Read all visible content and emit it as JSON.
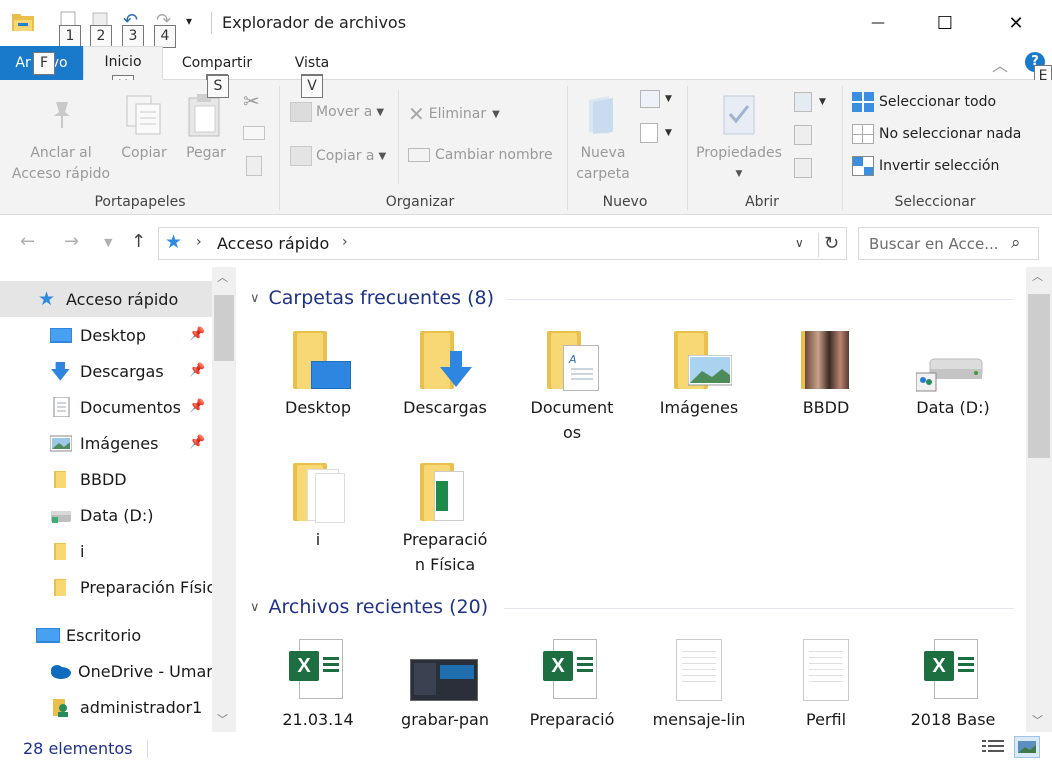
{
  "window": {
    "title": "Explorador de archivos",
    "qat_keytips": [
      "1",
      "2",
      "3",
      "4"
    ],
    "controls": {
      "minimize": "—",
      "maximize": "☐",
      "close": "✕"
    }
  },
  "ribbon_tabs": {
    "file": "Archivo",
    "file_pre": "Ar",
    "file_post": "vo",
    "file_keytip": "F",
    "home": "Inicio",
    "home_keytip": "H",
    "share": "Compartir",
    "share_keytip": "S",
    "view": "Vista",
    "view_keytip": "V",
    "help_keytip": "E"
  },
  "ribbon": {
    "portapapeles": {
      "label": "Portapapeles",
      "pin_line1": "Anclar al",
      "pin_line2": "Acceso rápido",
      "copy": "Copiar",
      "paste": "Pegar"
    },
    "organizar": {
      "label": "Organizar",
      "move_to": "Mover a",
      "copy_to": "Copiar a",
      "delete": "Eliminar",
      "rename": "Cambiar nombre"
    },
    "nuevo": {
      "label": "Nuevo",
      "new_folder_line1": "Nueva",
      "new_folder_line2": "carpeta"
    },
    "abrir": {
      "label": "Abrir",
      "properties": "Propiedades"
    },
    "seleccionar": {
      "label": "Seleccionar",
      "select_all": "Seleccionar todo",
      "select_none": "No seleccionar nada",
      "invert": "Invertir selección"
    }
  },
  "address": {
    "path": "Acceso rápido",
    "search_placeholder": "Buscar en Acce..."
  },
  "nav": {
    "items": [
      {
        "label": "Acceso rápido",
        "pinned": false
      },
      {
        "label": "Desktop",
        "pinned": true
      },
      {
        "label": "Descargas",
        "pinned": true
      },
      {
        "label": "Documentos",
        "pinned": true
      },
      {
        "label": "Imágenes",
        "pinned": true
      },
      {
        "label": "BBDD",
        "pinned": false
      },
      {
        "label": "Data (D:)",
        "pinned": false
      },
      {
        "label": "i",
        "pinned": false
      },
      {
        "label": "Preparación Física",
        "pinned": false
      },
      {
        "label": "Escritorio",
        "pinned": false
      },
      {
        "label": "OneDrive - Umar",
        "pinned": false
      },
      {
        "label": "administrador1",
        "pinned": false
      }
    ]
  },
  "frequent": {
    "header": "Carpetas frecuentes (8)",
    "items": [
      {
        "line1": "Desktop",
        "line2": ""
      },
      {
        "line1": "Descargas",
        "line2": ""
      },
      {
        "line1": "Document",
        "line2": "os"
      },
      {
        "line1": "Imágenes",
        "line2": ""
      },
      {
        "line1": "BBDD",
        "line2": ""
      },
      {
        "line1": "Data (D:)",
        "line2": ""
      },
      {
        "line1": "i",
        "line2": ""
      },
      {
        "line1": "Preparació",
        "line2": "n Física"
      }
    ]
  },
  "recent": {
    "header": "Archivos recientes (20)",
    "items": [
      {
        "label": "21.03.14"
      },
      {
        "label": "grabar-pan"
      },
      {
        "label": "Preparació"
      },
      {
        "label": "mensaje-lin"
      },
      {
        "label": "Perfil"
      },
      {
        "label": "2018 Base"
      }
    ]
  },
  "status": {
    "count": "28 elementos"
  },
  "colors": {
    "accent": "#1979ca",
    "header_text": "#1e3287",
    "folder": "#f8d775",
    "excel": "#1d6f42"
  }
}
